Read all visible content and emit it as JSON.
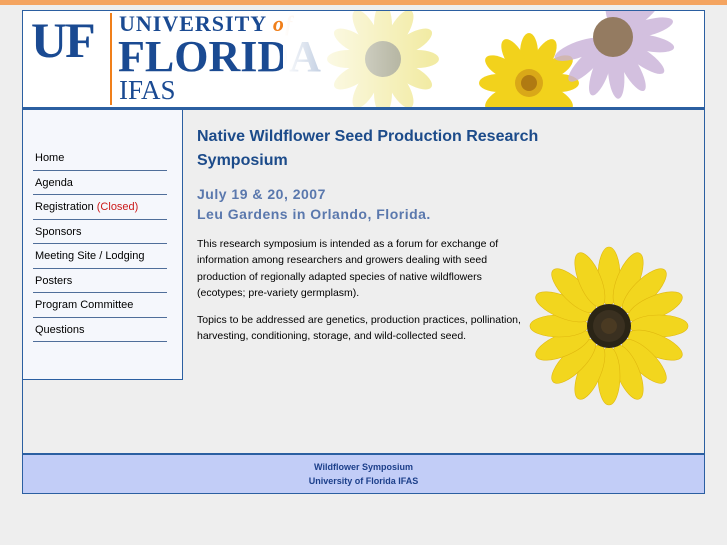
{
  "header": {
    "uf_mark": "UF",
    "university_text": "UNIVERSITY",
    "of_text": "of",
    "florida_text": "FLORIDA",
    "ifas_text": "IFAS"
  },
  "nav": {
    "items": [
      {
        "label": "Home"
      },
      {
        "label": "Agenda"
      },
      {
        "label": "Registration",
        "suffix": "(Closed)"
      },
      {
        "label": "Sponsors"
      },
      {
        "label": "Meeting Site / Lodging"
      },
      {
        "label": "Posters"
      },
      {
        "label": "Program Committee"
      },
      {
        "label": "Questions"
      }
    ]
  },
  "main": {
    "title": "Native Wildflower Seed Production Research Symposium",
    "date_line": "July 19 & 20, 2007",
    "location_line": "Leu Gardens in Orlando, Florida.",
    "paragraph1": "This research symposium is intended as a forum for exchange of information among researchers and growers dealing with seed production of regionally adapted species of native wildflowers (ecotypes; pre-variety germplasm).",
    "paragraph2": "Topics to be addressed are genetics, production practices, pollination, harvesting, conditioning, storage, and wild-collected seed."
  },
  "footer": {
    "line1": "Wildflower Symposium",
    "line2": "University of Florida IFAS"
  },
  "colors": {
    "brand_blue": "#1a4a92",
    "brand_orange": "#f07f1a",
    "footer_bg": "#c2cdf7",
    "closed_red": "#cc1a1a"
  }
}
